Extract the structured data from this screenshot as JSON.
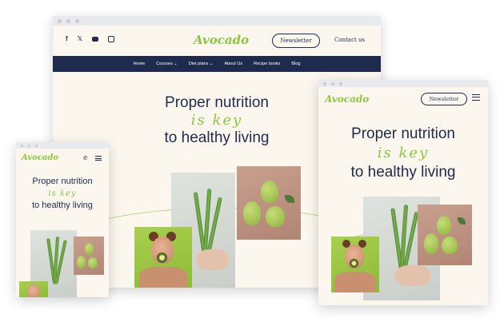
{
  "desktop": {
    "logo": "Avocado",
    "newsletter": "Newsletter",
    "contact": "Contact us",
    "social_icons": [
      "facebook-icon",
      "x-icon",
      "youtube-icon",
      "instagram-icon"
    ],
    "nav": [
      "Home",
      "Courses ⌄",
      "Diet plans ⌄",
      "About Us",
      "Recipe books",
      "Blog"
    ],
    "hero": {
      "line1": "Proper nutrition",
      "line2": "is key",
      "line3": "to healthy living"
    }
  },
  "tablet": {
    "logo": "Avocado",
    "newsletter": "Newsletter",
    "hero": {
      "line1": "Proper nutrition",
      "line2": "is key",
      "line3": "to healthy living"
    }
  },
  "mobile": {
    "logo": "Avocado",
    "hero": {
      "line1": "Proper nutrition",
      "line2": "is key",
      "line3": "to healthy living"
    }
  },
  "colors": {
    "accent": "#8cc63f",
    "navy": "#1f2b4d",
    "background": "#fbf7ee"
  }
}
